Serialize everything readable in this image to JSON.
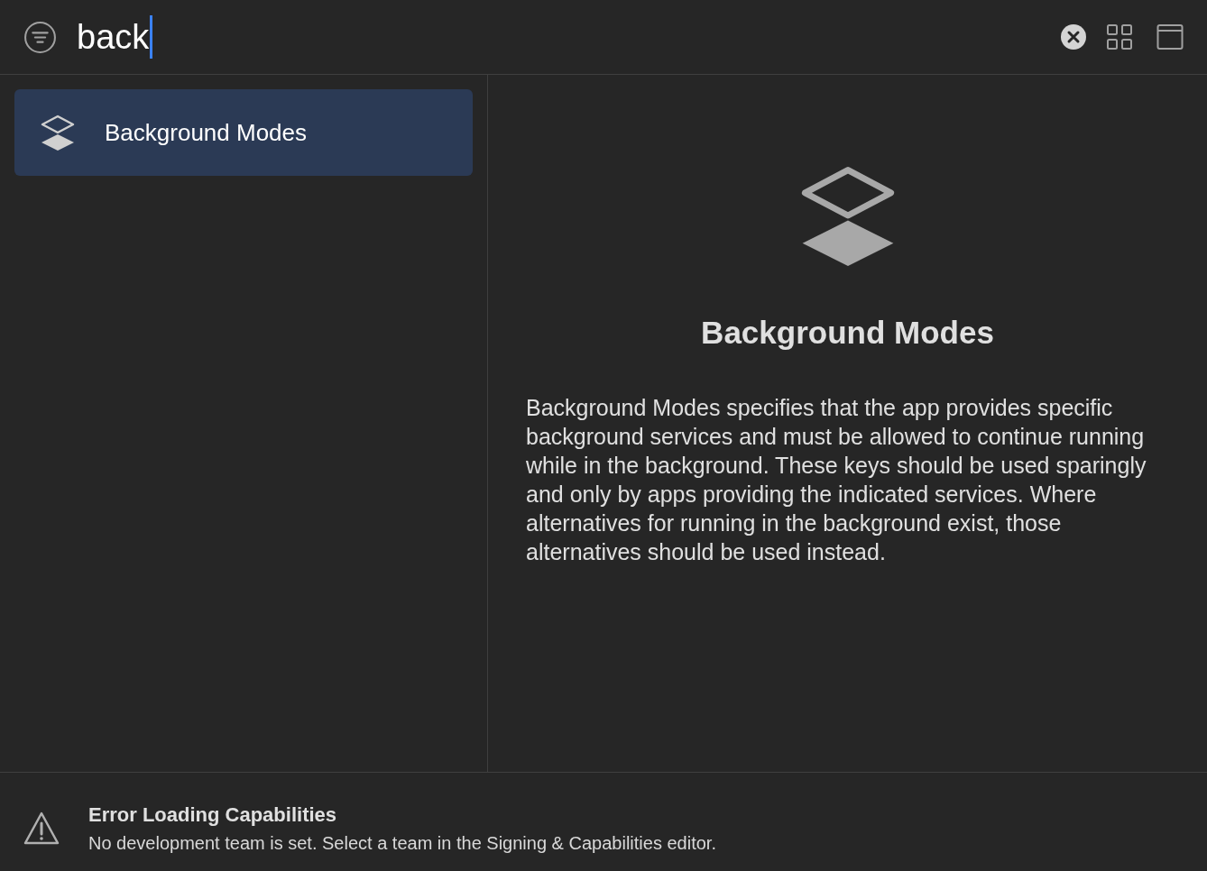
{
  "search": {
    "value": "back"
  },
  "capabilities": [
    {
      "label": "Background Modes",
      "selected": true
    }
  ],
  "detail": {
    "title": "Background Modes",
    "description": "Background Modes specifies that the app provides specific background services and must be allowed to continue running while in the background. These keys should be used sparingly and only by apps providing the indicated services. Where alternatives for running in the background exist, those alternatives should be used instead."
  },
  "error": {
    "title": "Error Loading Capabilities",
    "message": "No development team is set. Select a team in the Signing & Capabilities editor."
  }
}
